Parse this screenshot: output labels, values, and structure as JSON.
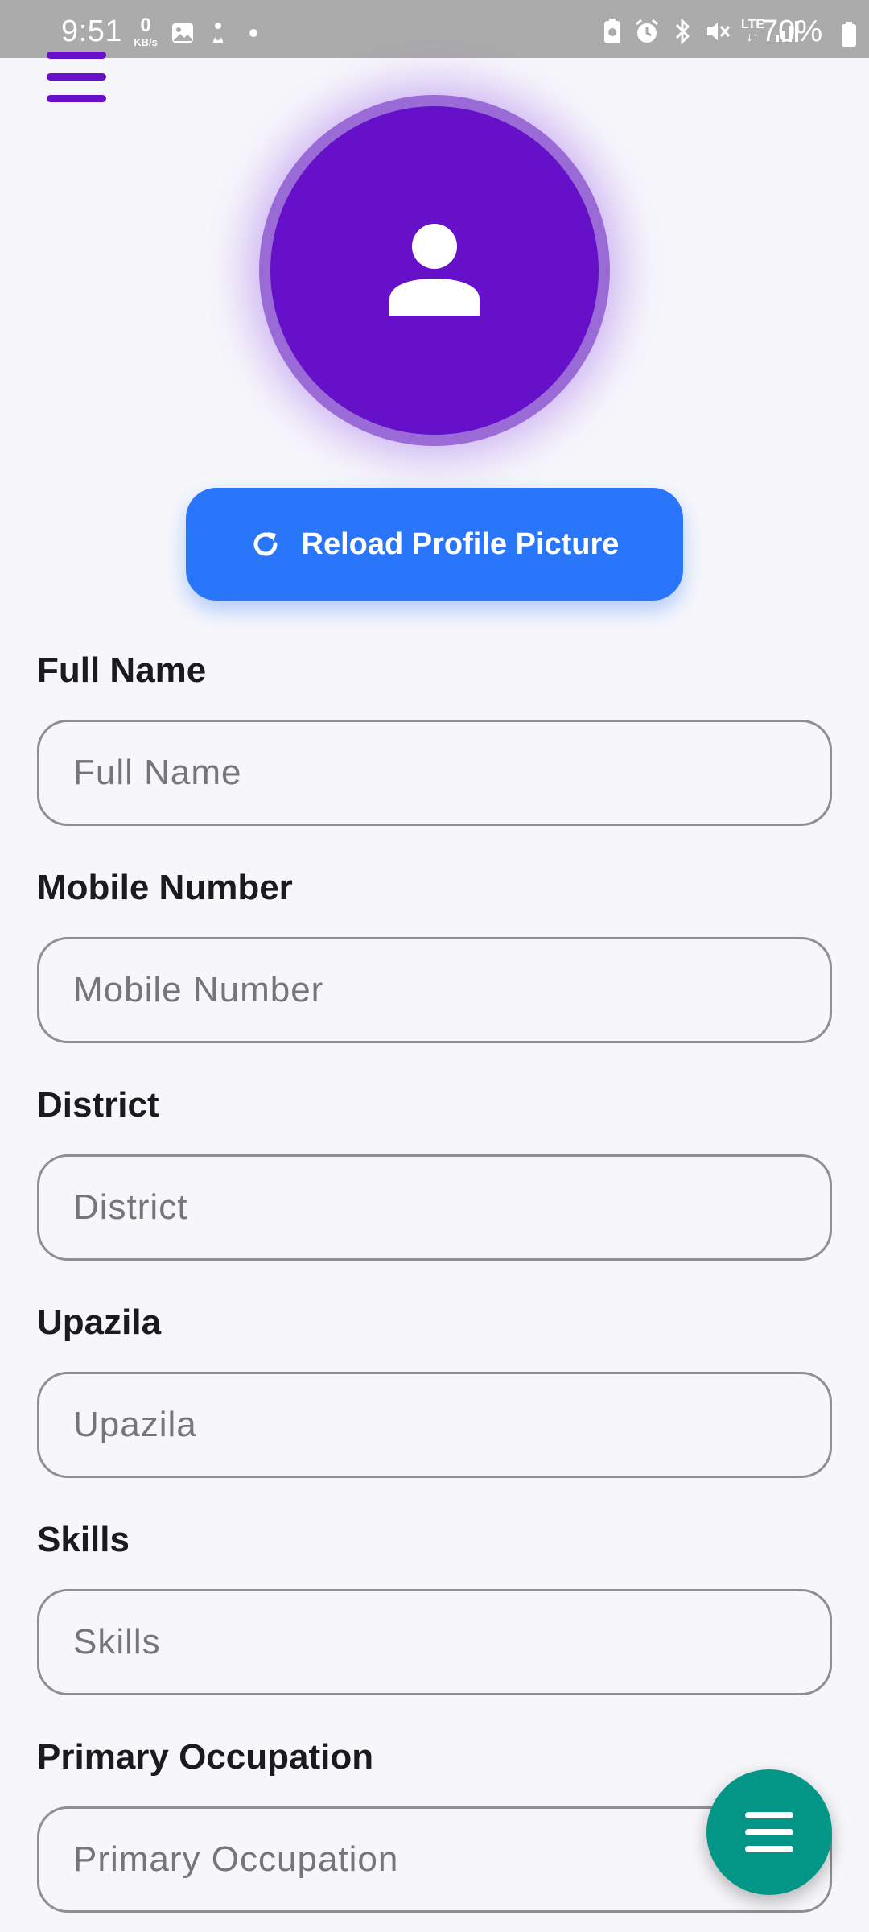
{
  "status_bar": {
    "time": "9:51",
    "data_rate_value": "0",
    "data_rate_unit": "KB/s",
    "network_type": "LTE",
    "battery_percent": "70%"
  },
  "profile": {
    "reload_button_label": "Reload Profile Picture"
  },
  "form": {
    "fields": [
      {
        "label": "Full Name",
        "placeholder": "Full Name",
        "value": ""
      },
      {
        "label": "Mobile Number",
        "placeholder": "Mobile Number",
        "value": ""
      },
      {
        "label": "District",
        "placeholder": "District",
        "value": ""
      },
      {
        "label": "Upazila",
        "placeholder": "Upazila",
        "value": ""
      },
      {
        "label": "Skills",
        "placeholder": "Skills",
        "value": ""
      },
      {
        "label": "Primary Occupation",
        "placeholder": "Primary Occupation",
        "value": ""
      }
    ]
  },
  "colors": {
    "status_bar": "#ababab",
    "accent_purple": "#6610c9",
    "reload_blue": "#2a76fb",
    "fab_teal": "#039686",
    "background": "#f7f7fb"
  },
  "icons": {
    "menu": "hamburger-menu-icon",
    "avatar": "user-icon",
    "reload": "refresh-icon",
    "fab": "menu-icon"
  }
}
